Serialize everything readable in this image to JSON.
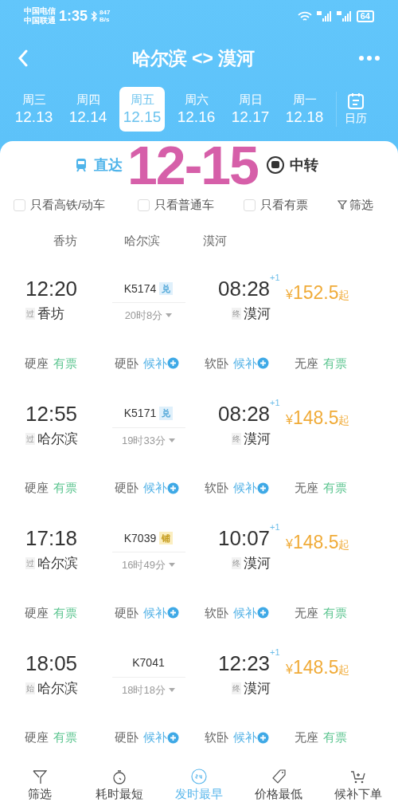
{
  "status_bar": {
    "carriers": [
      "中国电信",
      "中国联通"
    ],
    "time": "1:35",
    "speed": [
      "847",
      "B/s"
    ],
    "battery": "64"
  },
  "header": {
    "title": "哈尔滨 <> 漠河"
  },
  "dates": [
    {
      "weekday": "周三",
      "date": "12.13",
      "selected": false
    },
    {
      "weekday": "周四",
      "date": "12.14",
      "selected": false
    },
    {
      "weekday": "周五",
      "date": "12.15",
      "selected": true
    },
    {
      "weekday": "周六",
      "date": "12.16",
      "selected": false
    },
    {
      "weekday": "周日",
      "date": "12.17",
      "selected": false
    },
    {
      "weekday": "周一",
      "date": "12.18",
      "selected": false
    }
  ],
  "calendar_label": "日历",
  "mode_tabs": [
    {
      "label": "直达",
      "selected": true
    },
    {
      "label": "中转",
      "selected": false
    }
  ],
  "annotation": "12-15",
  "filters": [
    {
      "label": "只看高铁/动车",
      "checked": false
    },
    {
      "label": "只看普通车",
      "checked": false
    },
    {
      "label": "只看有票",
      "checked": false
    }
  ],
  "filter_button": "筛选",
  "stations": [
    "香坊",
    "哈尔滨",
    "漠河"
  ],
  "trains": [
    {
      "depart": "12:20",
      "from_tag": "过",
      "from": "香坊",
      "number": "K5174",
      "badge": {
        "text": "兑",
        "color": "#dff0fb"
      },
      "duration": "20时8分",
      "arrive": "08:28",
      "day_offset": "+1",
      "to_tag": "终",
      "to": "漠河",
      "price": "¥152.5",
      "price_suffix": "起",
      "seats": [
        {
          "name": "硬座",
          "status": "有票",
          "kind": "available"
        },
        {
          "name": "硬卧",
          "status": "候补",
          "kind": "waitlist"
        },
        {
          "name": "软卧",
          "status": "候补",
          "kind": "waitlist"
        },
        {
          "name": "无座",
          "status": "有票",
          "kind": "available"
        }
      ]
    },
    {
      "depart": "12:55",
      "from_tag": "过",
      "from": "哈尔滨",
      "number": "K5171",
      "badge": {
        "text": "兑",
        "color": "#dff0fb"
      },
      "duration": "19时33分",
      "arrive": "08:28",
      "day_offset": "+1",
      "to_tag": "终",
      "to": "漠河",
      "price": "¥148.5",
      "price_suffix": "起",
      "seats": [
        {
          "name": "硬座",
          "status": "有票",
          "kind": "available"
        },
        {
          "name": "硬卧",
          "status": "候补",
          "kind": "waitlist"
        },
        {
          "name": "软卧",
          "status": "候补",
          "kind": "waitlist"
        },
        {
          "name": "无座",
          "status": "有票",
          "kind": "available"
        }
      ]
    },
    {
      "depart": "17:18",
      "from_tag": "过",
      "from": "哈尔滨",
      "number": "K7039",
      "badge": {
        "text": "铺",
        "color": "#fbeec0"
      },
      "duration": "16时49分",
      "arrive": "10:07",
      "day_offset": "+1",
      "to_tag": "终",
      "to": "漠河",
      "price": "¥148.5",
      "price_suffix": "起",
      "seats": [
        {
          "name": "硬座",
          "status": "有票",
          "kind": "available"
        },
        {
          "name": "硬卧",
          "status": "候补",
          "kind": "waitlist"
        },
        {
          "name": "软卧",
          "status": "候补",
          "kind": "waitlist"
        },
        {
          "name": "无座",
          "status": "有票",
          "kind": "available"
        }
      ]
    },
    {
      "depart": "18:05",
      "from_tag": "始",
      "from": "哈尔滨",
      "number": "K7041",
      "duration": "18时18分",
      "arrive": "12:23",
      "day_offset": "+1",
      "to_tag": "终",
      "to": "漠河",
      "price": "¥148.5",
      "price_suffix": "起",
      "seats": [
        {
          "name": "硬座",
          "status": "有票",
          "kind": "available"
        },
        {
          "name": "硬卧",
          "status": "候补",
          "kind": "waitlist"
        },
        {
          "name": "软卧",
          "status": "候补",
          "kind": "waitlist"
        },
        {
          "name": "无座",
          "status": "有票",
          "kind": "available"
        }
      ]
    }
  ],
  "bottom_nav": [
    {
      "label": "筛选",
      "kind": "filter",
      "selected": false
    },
    {
      "label": "耗时最短",
      "kind": "timer",
      "selected": false
    },
    {
      "label": "发时最早",
      "kind": "clock24",
      "selected": true
    },
    {
      "label": "价格最低",
      "kind": "tag",
      "selected": false
    },
    {
      "label": "候补下单",
      "kind": "cart",
      "selected": false
    }
  ]
}
